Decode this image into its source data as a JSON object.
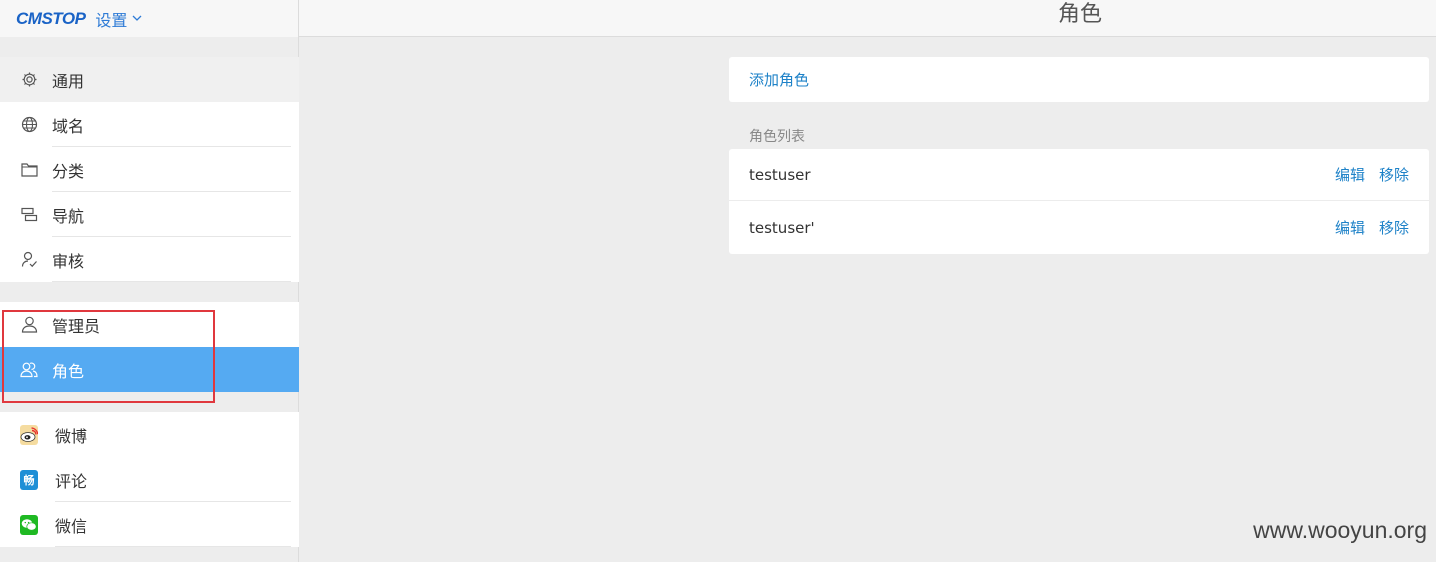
{
  "header": {
    "logo": "CMSTOP",
    "settings_label": "设置",
    "page_title": "角色"
  },
  "sidebar": {
    "groups": [
      {
        "items": [
          {
            "label": "通用",
            "icon": "gear-icon"
          },
          {
            "label": "域名",
            "icon": "globe-icon"
          },
          {
            "label": "分类",
            "icon": "folder-icon"
          },
          {
            "label": "导航",
            "icon": "navigation-icon"
          },
          {
            "label": "审核",
            "icon": "review-icon"
          }
        ]
      },
      {
        "items": [
          {
            "label": "管理员",
            "icon": "user-icon"
          },
          {
            "label": "角色",
            "icon": "users-icon"
          }
        ]
      },
      {
        "items": [
          {
            "label": "微博",
            "icon": "weibo-icon"
          },
          {
            "label": "评论",
            "icon": "changyan-icon",
            "icon_text": "畅"
          },
          {
            "label": "微信",
            "icon": "wechat-icon"
          }
        ]
      }
    ]
  },
  "main": {
    "add_role_label": "添加角色",
    "list_caption": "角色列表",
    "roles": [
      {
        "name": "testuser",
        "edit_label": "编辑",
        "remove_label": "移除"
      },
      {
        "name": "testuser'",
        "edit_label": "编辑",
        "remove_label": "移除"
      }
    ]
  },
  "watermark": "www.wooyun.org",
  "colors": {
    "accent": "#55aaf2",
    "link": "#1e82c8",
    "highlight_border": "#e0383e"
  }
}
